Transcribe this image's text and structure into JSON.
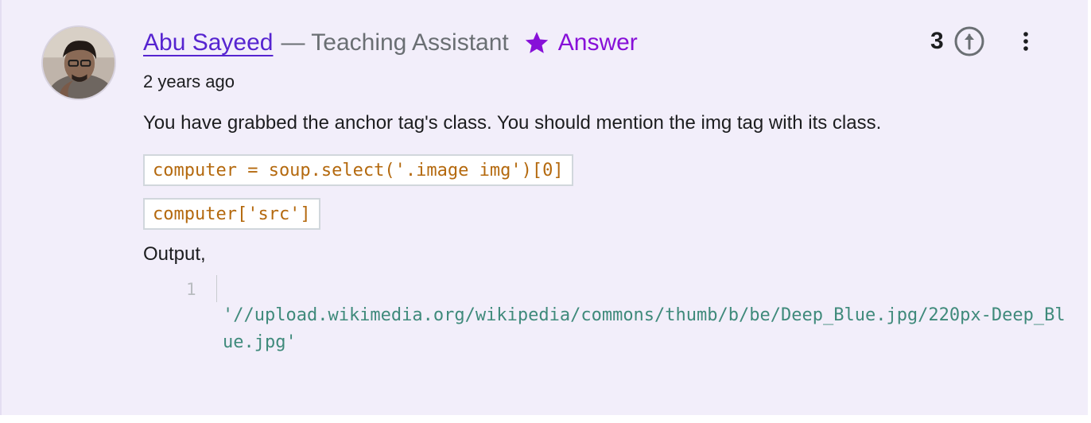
{
  "post": {
    "author": "Abu Sayeed",
    "role": "— Teaching Assistant",
    "badge": "Answer",
    "timestamp": "2 years ago",
    "votes": "3",
    "body": "You have grabbed the anchor tag's class. You should mention the img tag with its class.",
    "code_lines": [
      "computer = soup.select('.image img')[0]",
      "computer['src']"
    ],
    "output_label": "Output,",
    "output_block": {
      "line_number": "1",
      "text": "'//upload.wikimedia.org/wikipedia/commons/thumb/b/be/Deep_Blue.jpg/220px-Deep_Blue.jpg'"
    }
  },
  "icons": {
    "avatar": "avatar",
    "badge": "star-icon",
    "upvote": "arrow-up-circle-icon",
    "more": "more-vertical-icon"
  },
  "colors": {
    "card_background": "#f2eefa",
    "author_link": "#5624d0",
    "answer_badge": "#8710d8",
    "code_inline": "#b4690e",
    "code_output": "#3f8a7b"
  }
}
